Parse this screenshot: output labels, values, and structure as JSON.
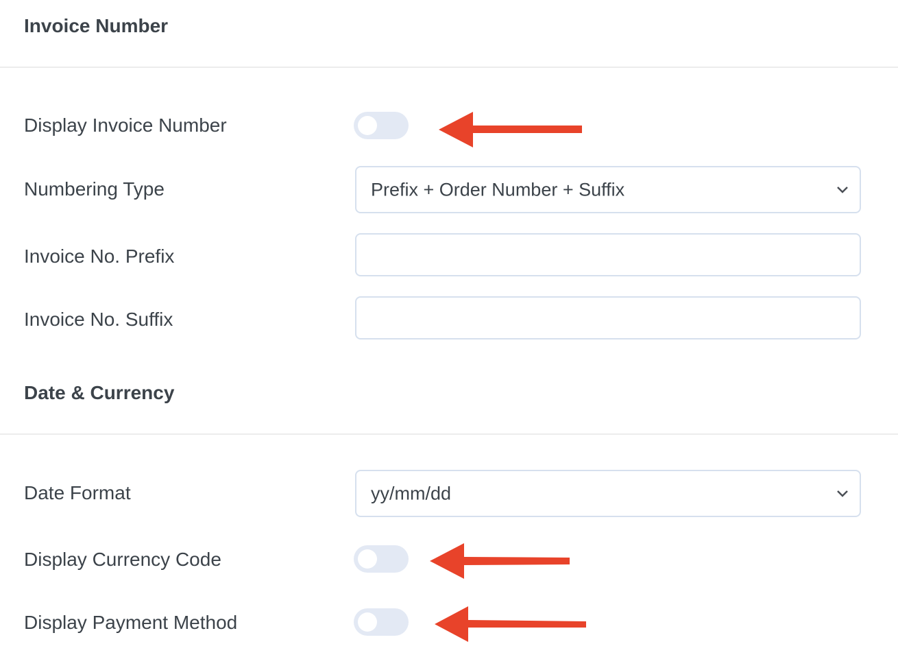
{
  "sections": {
    "invoice_number": {
      "title": "Invoice Number",
      "display_invoice_number": {
        "label": "Display Invoice Number",
        "enabled": false
      },
      "numbering_type": {
        "label": "Numbering Type",
        "selected": "Prefix + Order Number + Suffix"
      },
      "prefix": {
        "label": "Invoice No. Prefix",
        "value": "",
        "placeholder": ""
      },
      "suffix": {
        "label": "Invoice No. Suffix",
        "value": "",
        "placeholder": ""
      }
    },
    "date_currency": {
      "title": "Date & Currency",
      "date_format": {
        "label": "Date Format",
        "selected": "yy/mm/dd"
      },
      "display_currency_code": {
        "label": "Display Currency Code",
        "enabled": false
      },
      "display_payment_method": {
        "label": "Display Payment Method",
        "enabled": false
      }
    }
  },
  "annotations": {
    "arrow_color": "#e8432a",
    "arrows": [
      "display-invoice-number-toggle",
      "display-currency-code-toggle",
      "display-payment-method-toggle"
    ]
  },
  "colors": {
    "toggle_off": "#e3e9f4",
    "input_border": "#d6e0ee",
    "text": "#3c434a"
  }
}
